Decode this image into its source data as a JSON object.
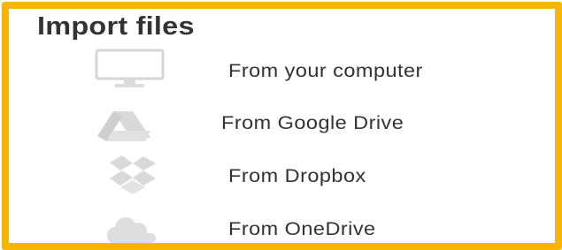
{
  "dialog": {
    "title": "Import files",
    "frame_color": "#f7b500",
    "text_color": "#333333",
    "icon_color": "#d3d3d3"
  },
  "sources": [
    {
      "id": "computer",
      "label": "From your computer",
      "icon": "monitor-icon"
    },
    {
      "id": "google-drive",
      "label": "From Google Drive",
      "icon": "google-drive-icon"
    },
    {
      "id": "dropbox",
      "label": "From Dropbox",
      "icon": "dropbox-icon"
    },
    {
      "id": "onedrive",
      "label": "From OneDrive",
      "icon": "onedrive-cloud-icon"
    }
  ]
}
